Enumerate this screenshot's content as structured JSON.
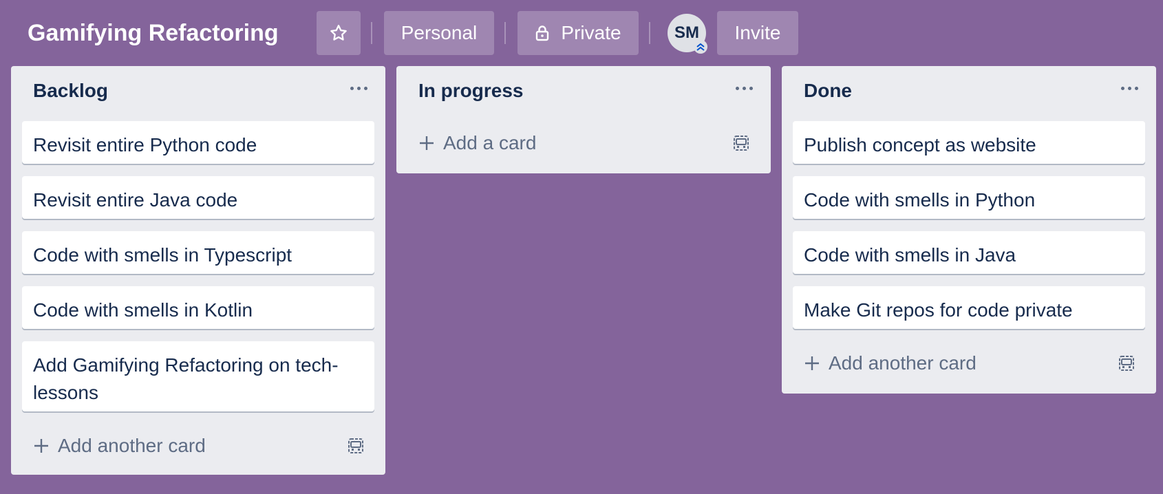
{
  "header": {
    "title": "Gamifying Refactoring",
    "star_icon": "star-icon",
    "personal_label": "Personal",
    "private_label": "Private",
    "lock_icon": "lock-icon",
    "avatar_initials": "SM",
    "invite_label": "Invite"
  },
  "colors": {
    "board_background": "#84649b",
    "list_background": "#ebecf0",
    "card_background": "#ffffff",
    "text_primary": "#172b4d",
    "text_secondary": "#5e6c84"
  },
  "lists": [
    {
      "title": "Backlog",
      "cards": [
        "Revisit entire Python code",
        "Revisit entire Java code",
        "Code with smells in Typescript",
        "Code with smells in Kotlin",
        "Add Gamifying Refactoring on tech-lessons"
      ],
      "add_label": "Add another card"
    },
    {
      "title": "In progress",
      "cards": [],
      "add_label": "Add a card"
    },
    {
      "title": "Done",
      "cards": [
        "Publish concept as website",
        "Code with smells in Python",
        "Code with smells in Java",
        "Make Git repos for code private"
      ],
      "add_label": "Add another card"
    }
  ]
}
